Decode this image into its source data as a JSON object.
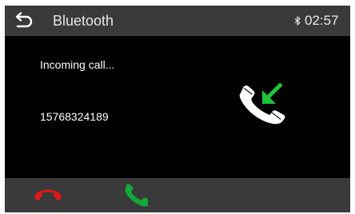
{
  "header": {
    "back_icon": "back-arrow-icon",
    "title": "Bluetooth",
    "bluetooth_icon": "bluetooth-icon",
    "time": "02:57"
  },
  "call": {
    "status": "Incoming call...",
    "number": "15768324189",
    "icon": "incoming-call-icon"
  },
  "footer": {
    "decline_icon": "hang-up-icon",
    "answer_icon": "answer-call-icon"
  },
  "colors": {
    "background": "#000000",
    "bar": "#3a3a3a",
    "decline": "#e01818",
    "answer": "#12a83a",
    "incoming_arrow": "#1ec43a"
  }
}
